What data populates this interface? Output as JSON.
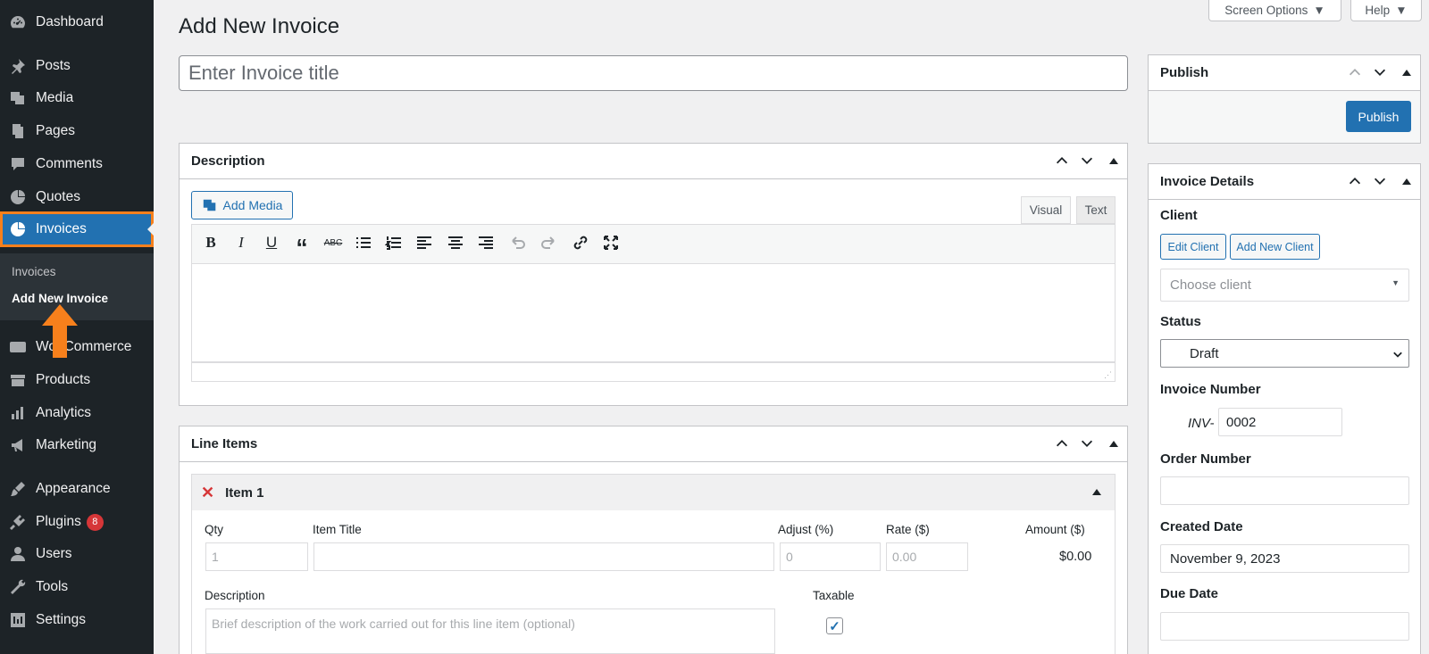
{
  "sidebar": {
    "items": [
      {
        "label": "Dashboard",
        "icon": "dashboard-icon"
      },
      {
        "label": "Posts",
        "icon": "pin-icon"
      },
      {
        "label": "Media",
        "icon": "media-icon"
      },
      {
        "label": "Pages",
        "icon": "pages-icon"
      },
      {
        "label": "Comments",
        "icon": "comment-icon"
      },
      {
        "label": "Quotes",
        "icon": "pie-icon"
      },
      {
        "label": "Invoices",
        "icon": "pie-icon"
      },
      {
        "label": "WooCommerce",
        "icon": "woo-icon"
      },
      {
        "label": "Products",
        "icon": "archive-icon"
      },
      {
        "label": "Analytics",
        "icon": "chart-bar-icon"
      },
      {
        "label": "Marketing",
        "icon": "megaphone-icon"
      },
      {
        "label": "Appearance",
        "icon": "brush-icon"
      },
      {
        "label": "Plugins",
        "icon": "plugin-icon",
        "badge": "8"
      },
      {
        "label": "Users",
        "icon": "user-icon"
      },
      {
        "label": "Tools",
        "icon": "wrench-icon"
      },
      {
        "label": "Settings",
        "icon": "settings-icon"
      }
    ],
    "submenu": [
      "Invoices",
      "Add New Invoice"
    ]
  },
  "top": {
    "screen_options": "Screen Options",
    "help": "Help"
  },
  "page_title": "Add New Invoice",
  "title_placeholder": "Enter Invoice title",
  "description_box": {
    "title": "Description",
    "add_media": "Add Media",
    "tab_visual": "Visual",
    "tab_text": "Text"
  },
  "line_items": {
    "title": "Line Items",
    "item_title": "Item 1",
    "labels": {
      "qty": "Qty",
      "item_title": "Item Title",
      "adjust": "Adjust (%)",
      "rate": "Rate ($)",
      "amount": "Amount ($)",
      "description": "Description",
      "taxable": "Taxable"
    },
    "qty_placeholder": "1",
    "adjust_placeholder": "0",
    "rate_placeholder": "0.00",
    "amount_value": "$0.00",
    "desc_placeholder": "Brief description of the work carried out for this line item (optional)",
    "taxable_checked": true
  },
  "publish": {
    "title": "Publish",
    "button": "Publish"
  },
  "invoice_details": {
    "title": "Invoice Details",
    "client_label": "Client",
    "edit_client": "Edit Client",
    "add_new_client": "Add New Client",
    "client_placeholder": "Choose client",
    "status_label": "Status",
    "status_value": "Draft",
    "invoice_number_label": "Invoice Number",
    "invoice_prefix": "INV-",
    "invoice_number": "0002",
    "order_number_label": "Order Number",
    "created_date_label": "Created Date",
    "created_date": "November 9, 2023",
    "due_date_label": "Due Date"
  },
  "colors": {
    "accent": "#2271b1",
    "sidebar": "#1d2327",
    "highlight": "#f7801c"
  }
}
